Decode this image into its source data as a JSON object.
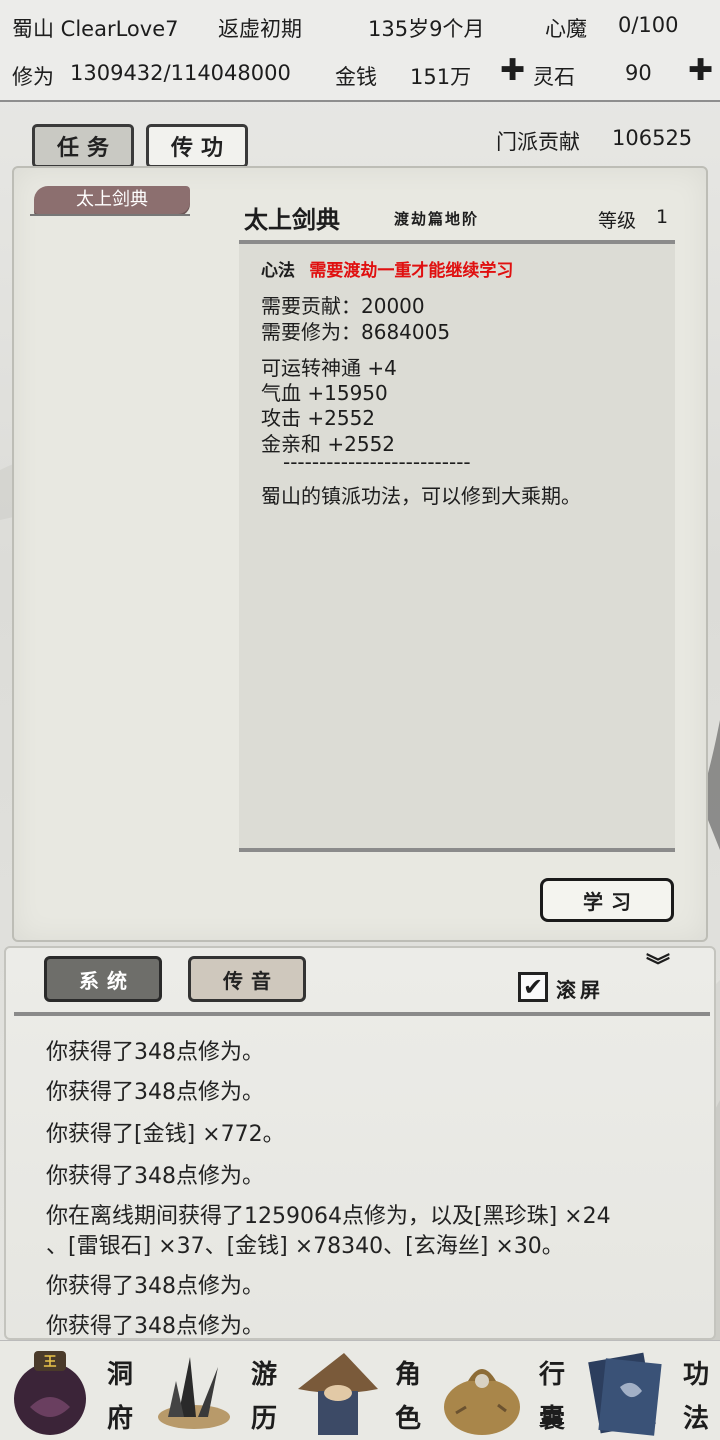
{
  "status": {
    "sect_name": "蜀山 ClearLove7",
    "realm": "返虚初期",
    "age": "135岁9个月",
    "demon_label": "心魔",
    "demon_value": "0/100",
    "cultivation_label": "修为",
    "cultivation_value": "1309432/114048000",
    "money_label": "金钱",
    "money_value": "151万",
    "spirit_stone_label": "灵石",
    "spirit_stone_value": "90"
  },
  "tabs": {
    "task": "任务",
    "transmit": "传功"
  },
  "contribution": {
    "label": "门派贡献",
    "value": "106525"
  },
  "skill_list": [
    {
      "label": "太上剑典"
    }
  ],
  "detail": {
    "title": "太上剑典",
    "subtitle": "渡劫篇地阶",
    "level_label": "等级",
    "level_value": "1",
    "req_label": "心法",
    "req_warning": "需要渡劫一重才能继续学习",
    "need_contribution": "需要贡献：20000",
    "need_cultivation": "需要修为：8684005",
    "stat1": "可运转神通 +4",
    "stat2": "气血 +15950",
    "stat3": "攻击 +2552",
    "stat4": "金亲和 +2552",
    "separator": "--------------------------",
    "description": "蜀山的镇派功法，可以修到大乘期。"
  },
  "learn_button": "学习",
  "log": {
    "tab_system": "系统",
    "tab_voice": "传音",
    "scroll_label": "滚屏",
    "scroll_checked": "✔",
    "lines": [
      "你获得了348点修为。",
      "你获得了348点修为。",
      "你获得了[金钱] ×772。",
      "你获得了348点修为。",
      "你在离线期间获得了1259064点修为，以及[黑珍珠] ×24",
      "、[雷银石] ×37、[金钱] ×78340、[玄海丝] ×30。",
      "你获得了348点修为。",
      "你获得了348点修为。"
    ]
  },
  "nav": [
    {
      "label1": "洞",
      "label2": "府",
      "icon": "cave-dwelling-icon"
    },
    {
      "label1": "游",
      "label2": "历",
      "icon": "travel-icon"
    },
    {
      "label1": "角",
      "label2": "色",
      "icon": "character-icon"
    },
    {
      "label1": "行",
      "label2": "囊",
      "icon": "bag-icon"
    },
    {
      "label1": "功",
      "label2": "法",
      "icon": "technique-book-icon"
    }
  ],
  "colors": {
    "warning": "#e01010",
    "tag_bg": "#8c6f6f",
    "panel_bg": "#e8e8e1",
    "detail_bg": "#dcdcd5"
  }
}
